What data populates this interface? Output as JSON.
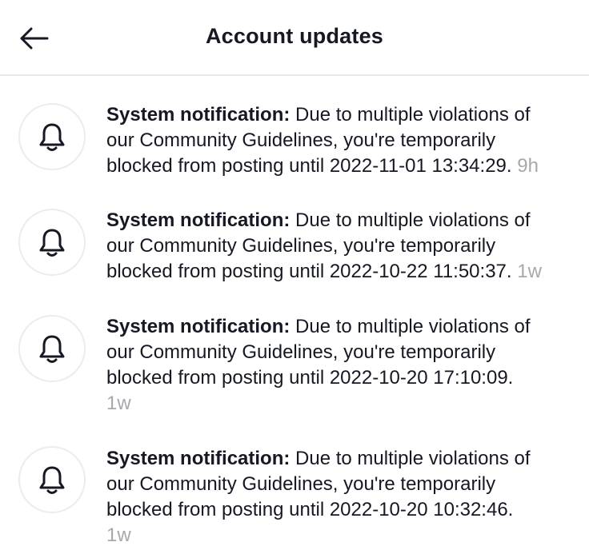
{
  "header": {
    "title": "Account updates",
    "back_icon": "back-arrow-icon"
  },
  "notifications": [
    {
      "icon": "bell-icon",
      "label": "System notification:",
      "line1": " Due to multiple violations of",
      "line2": "our Community Guidelines, you're temporarily",
      "line3": "blocked from posting until 2022-11-01 13:34:29.",
      "time": "9h"
    },
    {
      "icon": "bell-icon",
      "label": "System notification:",
      "line1": " Due to multiple violations of",
      "line2": "our Community Guidelines, you're temporarily",
      "line3": "blocked from posting until 2022-10-22 11:50:37.",
      "time": "1w"
    },
    {
      "icon": "bell-icon",
      "label": "System notification:",
      "line1": " Due to multiple violations of",
      "line2": "our Community Guidelines, you're temporarily",
      "line3": "blocked from posting until 2022-10-20 17:10:09.",
      "time": "1w"
    },
    {
      "icon": "bell-icon",
      "label": "System notification:",
      "line1": " Due to multiple violations of",
      "line2": "our Community Guidelines, you're temporarily",
      "line3": "blocked from posting until 2022-10-20 10:32:46.",
      "time": "1w"
    }
  ]
}
